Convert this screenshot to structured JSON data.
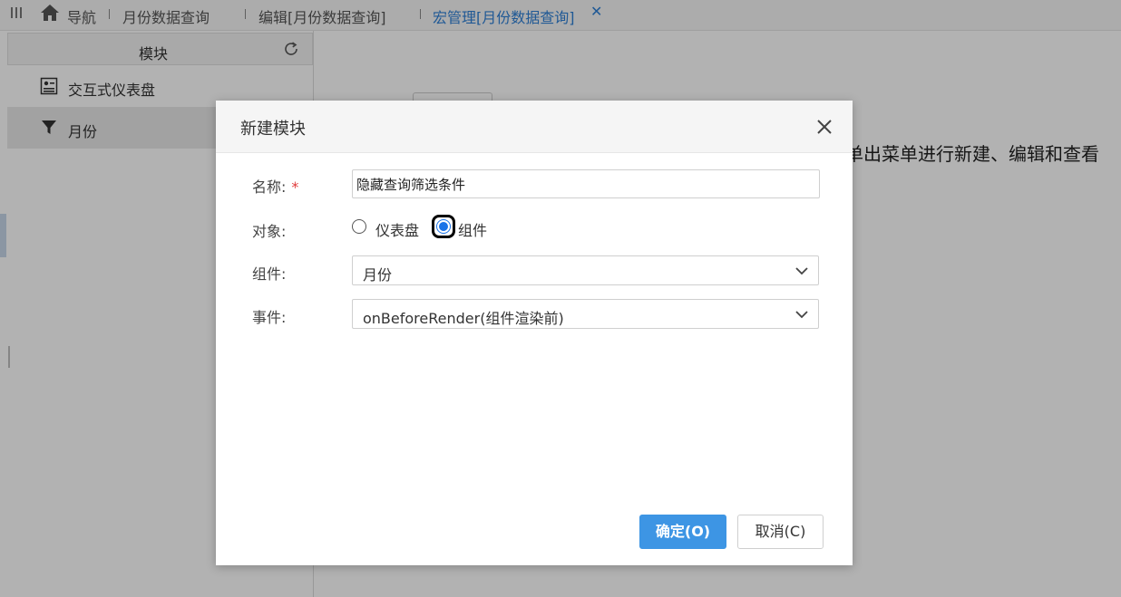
{
  "tabs": {
    "home": "导航",
    "items": [
      "月份数据查询",
      "编辑[月份数据查询]",
      "宏管理[月份数据查询]"
    ],
    "close_symbol": "✕"
  },
  "sidebar": {
    "title": "模块",
    "items": [
      {
        "label": "交互式仪表盘",
        "icon": "dashboard-icon"
      },
      {
        "label": "月份",
        "icon": "filter-icon"
      }
    ]
  },
  "main": {
    "hint": "单出菜单进行新建、编辑和查看"
  },
  "dialog": {
    "title": "新建模块",
    "name_label": "名称:",
    "required_mark": "*",
    "name_value": "隐藏查询筛选条件",
    "target_label": "对象:",
    "target_options": [
      "仪表盘",
      "组件"
    ],
    "target_selected": "组件",
    "component_label": "组件:",
    "component_value": "月份",
    "event_label": "事件:",
    "event_value": "onBeforeRender(组件渲染前)",
    "ok_label": "确定(O)",
    "cancel_label": "取消(C)"
  },
  "colors": {
    "accent": "#3d95e4",
    "active_tab": "#2f80d6",
    "required": "#e03b3b"
  }
}
